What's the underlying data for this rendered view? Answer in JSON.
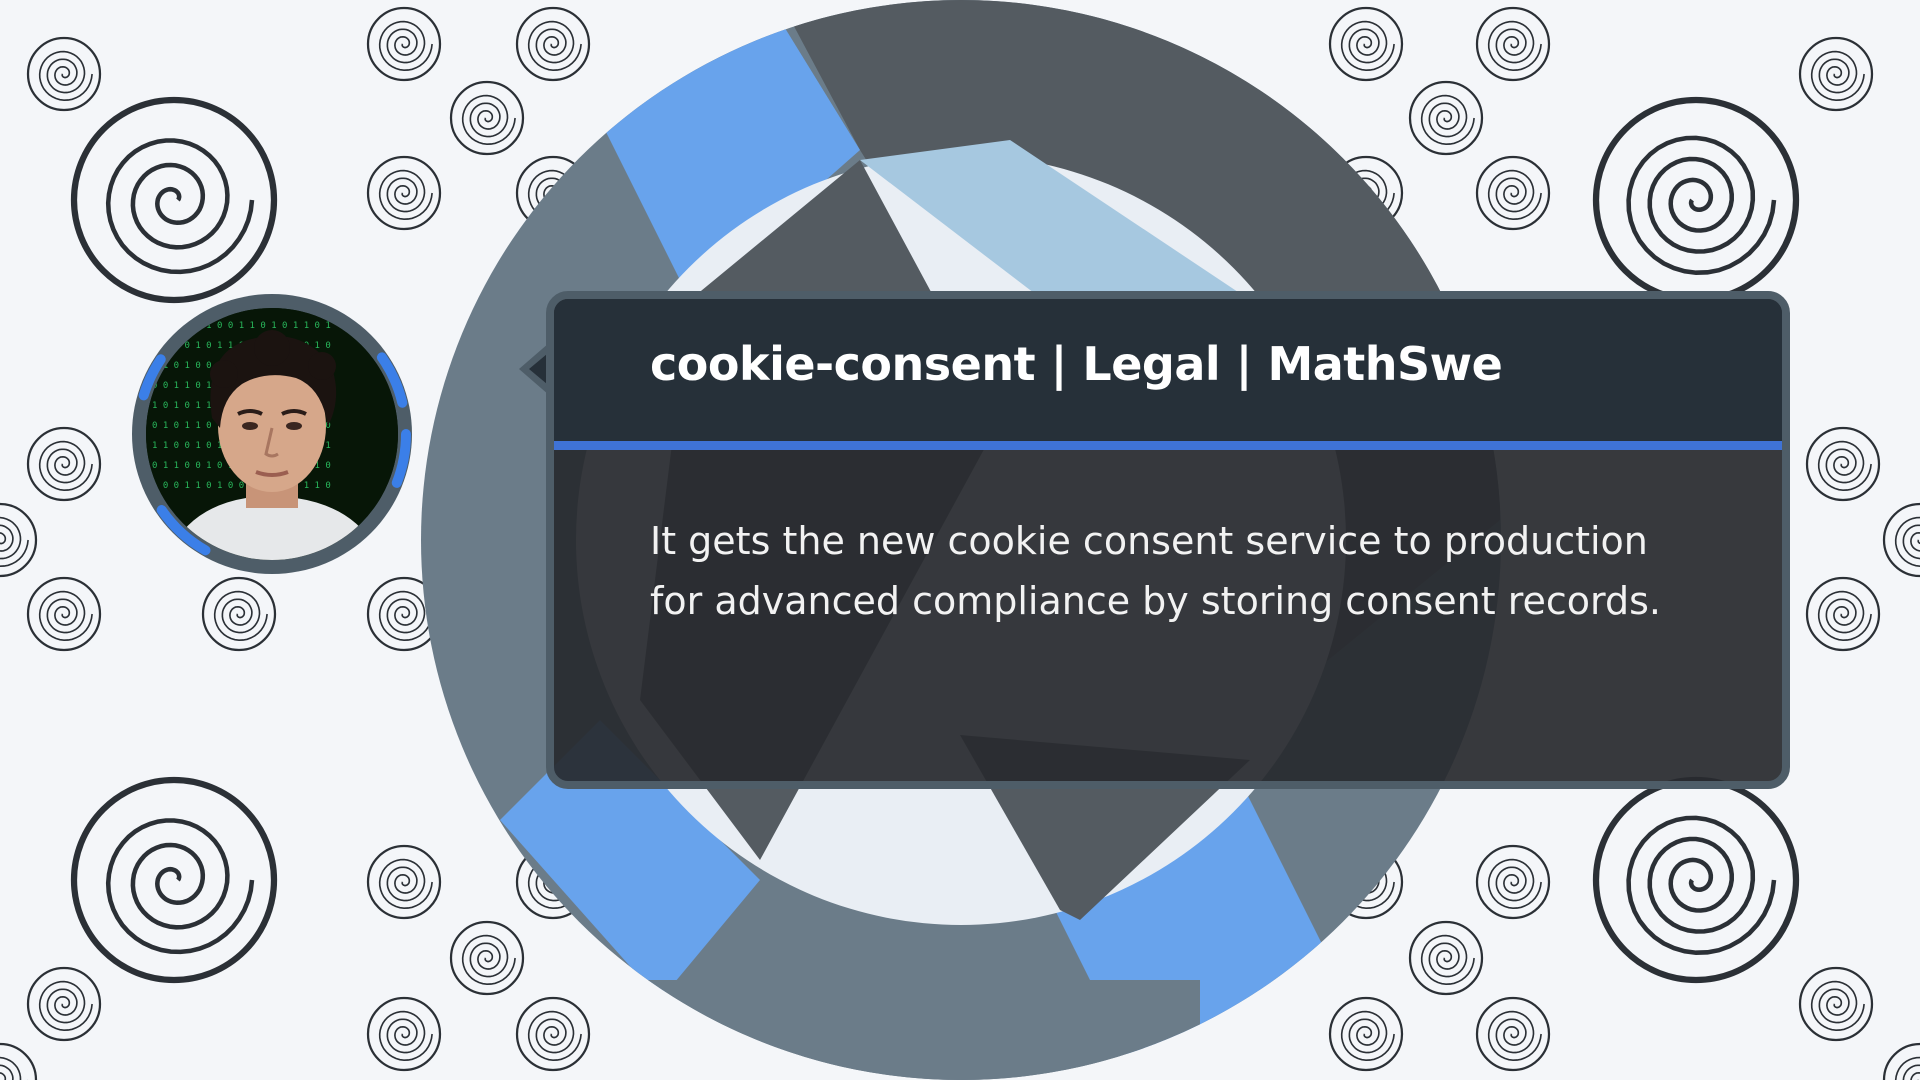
{
  "popup": {
    "title": "cookie-consent | Legal | MathSwe",
    "description": "It gets the new cookie consent service to production for advanced compliance by storing consent records."
  },
  "icons": {
    "background": "spiral-icon",
    "logo": "mathswe-logo-icon",
    "avatar": "author-avatar"
  },
  "colors": {
    "background": "#f4f6f9",
    "ring_gray": "#6b7c89",
    "ring_dark": "#545b61",
    "ring_blue": "#68a3ec",
    "ring_light_blue": "#a6c8e0",
    "card_header": "#263039",
    "card_body": "#2c2d30",
    "accent": "#3f73d6",
    "spiral": "#2b3036"
  }
}
